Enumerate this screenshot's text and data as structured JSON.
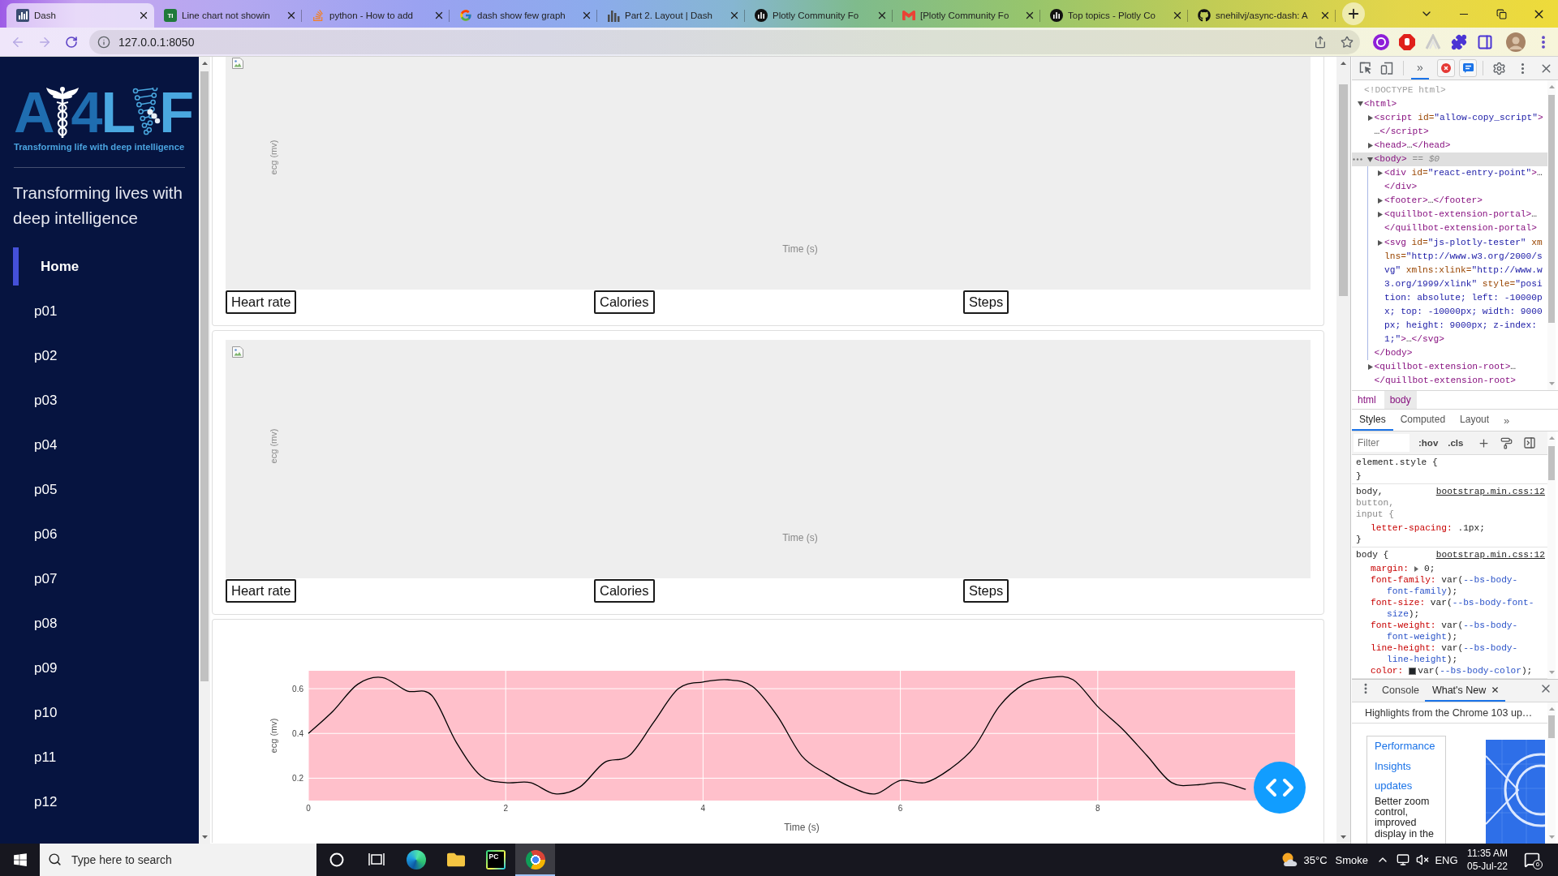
{
  "browser": {
    "tabs": [
      {
        "title": "Dash",
        "selected": true,
        "kind": "dash"
      },
      {
        "title": "Line chart not showin",
        "selected": false,
        "kind": "badge",
        "favicon_text": "TI"
      },
      {
        "title": "python - How to add",
        "selected": false,
        "kind": "stack"
      },
      {
        "title": "dash show few graph",
        "selected": false,
        "kind": "google"
      },
      {
        "title": "Part 2. Layout | Dash",
        "selected": false,
        "kind": "bars"
      },
      {
        "title": "Plotly Community Fo",
        "selected": false,
        "kind": "disc"
      },
      {
        "title": "[Plotly Community Fo",
        "selected": false,
        "kind": "mail"
      },
      {
        "title": "Top topics - Plotly Co",
        "selected": false,
        "kind": "disc"
      },
      {
        "title": "snehilvj/async-dash: A",
        "selected": false,
        "kind": "octocat"
      }
    ],
    "nav_buttons": [
      {
        "kind": "back",
        "disabled": true
      },
      {
        "kind": "forward",
        "disabled": true
      },
      {
        "kind": "reload",
        "disabled": false
      }
    ],
    "url": "127.0.0.1:8050"
  },
  "sidebar": {
    "logo": {
      "parts": [
        {
          "kind": "letters",
          "text": "A",
          "color": "#1f6db0"
        },
        {
          "kind": "caduceus"
        },
        {
          "kind": "letters",
          "text": "4",
          "color": "#1f6db0"
        },
        {
          "kind": "letters",
          "text": "L",
          "color": "#4aa8e0"
        },
        {
          "kind": "dna"
        },
        {
          "kind": "letters",
          "text": "F",
          "color": "#4aa8e0"
        }
      ],
      "tagline": "Transforming life with deep intelligence"
    },
    "heading": "Transforming lives with deep intelligence",
    "nav": [
      {
        "label": "Home",
        "selected": true
      },
      {
        "label": "p01",
        "selected": false
      },
      {
        "label": "p02",
        "selected": false
      },
      {
        "label": "p03",
        "selected": false
      },
      {
        "label": "p04",
        "selected": false
      },
      {
        "label": "p05",
        "selected": false
      },
      {
        "label": "p06",
        "selected": false
      },
      {
        "label": "p07",
        "selected": false
      },
      {
        "label": "p08",
        "selected": false
      },
      {
        "label": "p09",
        "selected": false
      },
      {
        "label": "p10",
        "selected": false
      },
      {
        "label": "p11",
        "selected": false
      },
      {
        "label": "p12",
        "selected": false
      }
    ]
  },
  "cards": [
    {
      "kind": "empty_graph",
      "ylabel": "ecg (mv)",
      "xlabel": "Time (s)",
      "buttons": [
        "Heart rate",
        "Calories",
        "Steps"
      ]
    },
    {
      "kind": "empty_graph",
      "ylabel": "ecg (mv)",
      "xlabel": "Time (s)",
      "buttons": [
        "Heart rate",
        "Calories",
        "Steps"
      ]
    },
    {
      "kind": "chart",
      "chart_data": {
        "type": "line",
        "xlabel": "Time (s)",
        "ylabel": "ecg (mv)",
        "x": [
          0,
          0.25,
          0.5,
          0.75,
          1,
          1.25,
          1.5,
          1.75,
          2,
          2.25,
          2.5,
          2.75,
          3,
          3.25,
          3.5,
          3.75,
          4,
          4.25,
          4.5,
          4.75,
          5,
          5.25,
          5.5,
          5.75,
          6,
          6.25,
          6.5,
          6.75,
          7,
          7.25,
          7.5,
          7.75,
          8,
          8.25,
          8.5,
          8.75,
          9,
          9.25,
          9.5
        ],
        "series": [
          {
            "color": "#000000",
            "values": [
              0.4,
              0.5,
              0.62,
              0.65,
              0.59,
              0.57,
              0.36,
              0.21,
              0.18,
              0.18,
              0.13,
              0.16,
              0.27,
              0.3,
              0.45,
              0.6,
              0.63,
              0.64,
              0.61,
              0.48,
              0.3,
              0.22,
              0.16,
              0.13,
              0.19,
              0.18,
              0.24,
              0.34,
              0.52,
              0.62,
              0.65,
              0.64,
              0.52,
              0.42,
              0.3,
              0.18,
              0.17,
              0.18,
              0.15
            ]
          }
        ],
        "xlim": [
          0,
          10
        ],
        "ylim": [
          0.1,
          0.68
        ],
        "xticks": [
          0,
          2,
          4,
          6,
          8
        ],
        "yticks": [
          0.2,
          0.4,
          0.6
        ],
        "grid": true
      }
    }
  ],
  "devtools": {
    "more_tabs": {
      "label": "»",
      "selected": true
    },
    "dom_tree": [
      {
        "kind": "doctype",
        "selected": false,
        "open": "<!DOCTYPE html>"
      },
      {
        "kind": "element",
        "selected": false,
        "expanded": true,
        "open": "<html>",
        "children": [
          {
            "kind": "element",
            "selected": false,
            "expanded": false,
            "open": "<script id=\"allow-copy_script\">",
            "content": "…",
            "close": "</script>"
          },
          {
            "kind": "element",
            "selected": false,
            "expanded": false,
            "open": "<head>",
            "content": "…",
            "close": "</head>"
          },
          {
            "kind": "element",
            "selected": true,
            "expanded": true,
            "open": "<body>",
            "marker": "== $0",
            "close": "</body>",
            "children": [
              {
                "kind": "element",
                "selected": false,
                "expanded": false,
                "open": "<div id=\"react-entry-point\">",
                "content": "…",
                "close": "</div>"
              },
              {
                "kind": "element",
                "selected": false,
                "expanded": false,
                "open": "<footer>",
                "content": "…",
                "close": "</footer>"
              },
              {
                "kind": "element",
                "selected": false,
                "expanded": false,
                "open": "<quillbot-extension-portal>",
                "content": "…",
                "close": "</quillbot-extension-portal>"
              },
              {
                "kind": "element",
                "selected": false,
                "expanded": false,
                "open": "<svg id=\"js-plotly-tester\" xmlns=\"http://www.w3.org/2000/svg\" xmlns:xlink=\"http://www.w3.org/1999/xlink\" style=\"position: absolute; left: -10000px; top: -10000px; width: 9000px; height: 9000px; z-index: 1;\">",
                "content": "…",
                "close": "</svg>"
              }
            ]
          },
          {
            "kind": "element",
            "selected": false,
            "expanded": false,
            "open": "<quillbot-extension-root>",
            "content": "…",
            "close": "</quillbot-extension-root>"
          }
        ]
      }
    ],
    "breadcrumbs": [
      {
        "label": "html",
        "selected": false
      },
      {
        "label": "body",
        "selected": true
      }
    ],
    "style_tabs": [
      {
        "label": "Styles",
        "selected": true
      },
      {
        "label": "Computed",
        "selected": false
      },
      {
        "label": "Layout",
        "selected": false
      }
    ],
    "style_tabs_more": "»",
    "filter": {
      "placeholder": "Filter"
    },
    "toggles": [
      ":hov",
      ".cls"
    ],
    "rules": [
      {
        "selectors": [
          {
            "text": "element.style {",
            "matched": true
          }
        ],
        "end": "}"
      },
      {
        "selectors": [
          {
            "text": "body,",
            "matched": true
          },
          {
            "text": "button,",
            "matched": false
          },
          {
            "text": "input {",
            "matched": false
          }
        ],
        "source": "bootstrap.min.css:12",
        "declarations": [
          {
            "property": "letter-spacing:",
            "value": ".1px;"
          }
        ],
        "end": "}"
      },
      {
        "selectors": [
          {
            "text": "body {",
            "matched": true
          }
        ],
        "source": "bootstrap.min.css:12",
        "declarations": [
          {
            "property": "margin:",
            "expandable": true,
            "value": "0;"
          },
          {
            "property": "font-family:",
            "value": "var(",
            "variable": "--bs-body-font-family",
            "tail": ");"
          },
          {
            "property": "font-size:",
            "value": "var(",
            "variable": "--bs-body-font-size",
            "tail": ");"
          },
          {
            "property": "font-weight:",
            "value": "var(",
            "variable": "--bs-body-font-weight",
            "tail": ");"
          },
          {
            "property": "line-height:",
            "value": "var(",
            "variable": "--bs-body-line-height",
            "tail": ");"
          },
          {
            "property": "color:",
            "color": "#212529",
            "value": "var(",
            "variable": "--bs-body-color",
            "tail": ");"
          }
        ]
      }
    ],
    "drawer_tabs": [
      {
        "label": "Console",
        "selected": false
      },
      {
        "label": "What's New",
        "selected": true,
        "closable": true
      }
    ],
    "whats_new": {
      "heading": "Highlights from the Chrome 103 up…",
      "link": "Performance Insights updates",
      "text": "Better zoom control, improved display in the"
    }
  },
  "taskbar": {
    "search": {
      "placeholder": "Type here to search"
    },
    "apps": [
      {
        "kind": "cortana",
        "selected": false
      },
      {
        "kind": "taskview",
        "selected": false
      },
      {
        "kind": "edge",
        "selected": false
      },
      {
        "kind": "explorer",
        "selected": false
      },
      {
        "kind": "pycharm",
        "selected": false,
        "label": "PC"
      },
      {
        "kind": "chrome",
        "selected": true
      }
    ],
    "weather": {
      "temperature": "35°C",
      "condition": "Smoke"
    },
    "volume_muted": true,
    "language": "ENG",
    "time": "11:35 AM",
    "date": "05-Jul-22",
    "notifications": "6"
  }
}
